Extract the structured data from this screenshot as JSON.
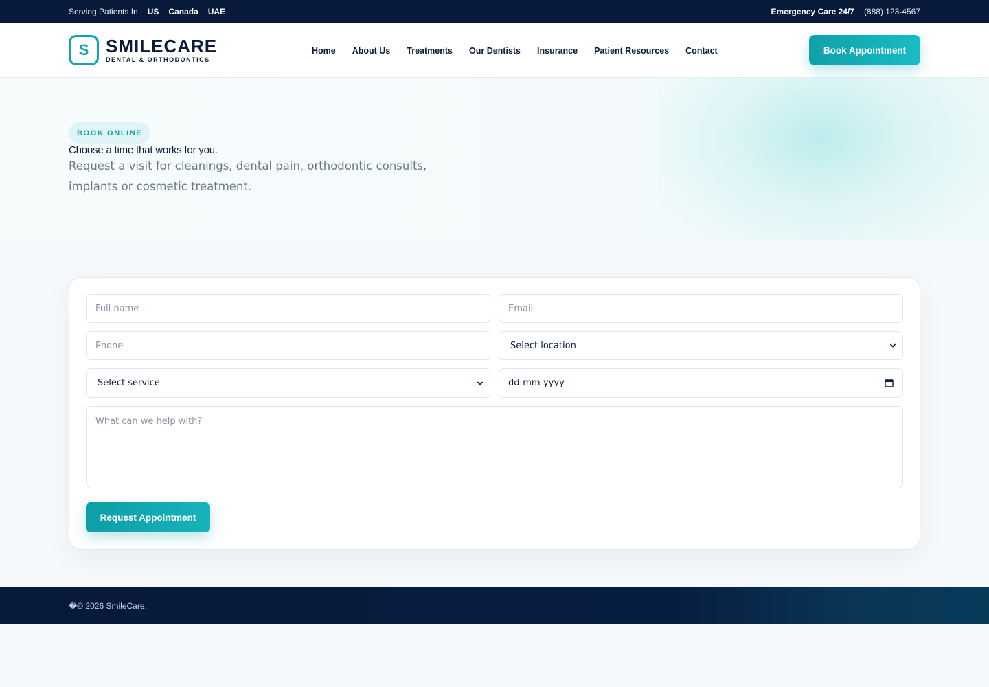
{
  "topbar": {
    "serving_label": "Serving Patients In",
    "countries": [
      "US",
      "Canada",
      "UAE"
    ],
    "emergency_label": "Emergency Care 24/7",
    "phone": "(888) 123-4567"
  },
  "header": {
    "logo_letter": "S",
    "logo_name": "SMILECARE",
    "logo_sub": "DENTAL & ORTHODONTICS",
    "nav": [
      "Home",
      "About Us",
      "Treatments",
      "Our Dentists",
      "Insurance",
      "Patient Resources",
      "Contact"
    ],
    "cta_label": "Book Appointment"
  },
  "hero": {
    "badge": "BOOK ONLINE",
    "title": "Choose a time that works for you.",
    "description": "Request a visit for cleanings, dental pain, orthodontic consults, implants or cosmetic treatment."
  },
  "form": {
    "full_name_placeholder": "Full name",
    "email_placeholder": "Email",
    "phone_placeholder": "Phone",
    "location_selected": "Select location",
    "service_selected": "Select service",
    "date_placeholder": "dd-mm-yyyy",
    "message_placeholder": "What can we help with?",
    "submit_label": "Request Appointment"
  },
  "footer": {
    "copyright": "�© 2026 SmileCare."
  },
  "colors": {
    "navy": "#071a3a",
    "teal": "#14a3ad",
    "text_muted": "#6b7787"
  }
}
